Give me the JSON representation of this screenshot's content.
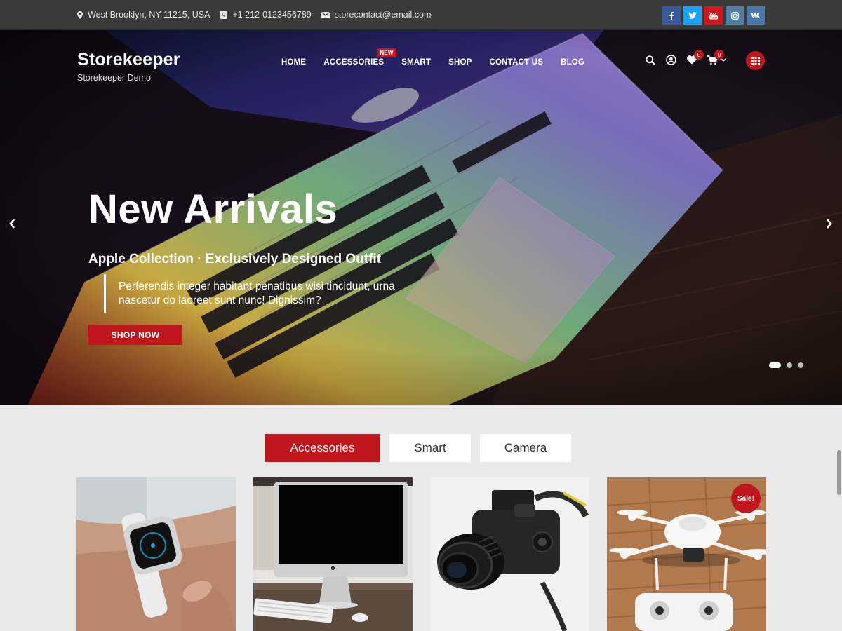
{
  "topbar": {
    "address": "West Brooklyn, NY 11215, USA",
    "phone": "+1 212-0123456789",
    "email": "storecontact@email.com",
    "social": [
      {
        "name": "facebook",
        "icon": "facebook-icon",
        "color": "#3b5998"
      },
      {
        "name": "twitter",
        "icon": "twitter-icon",
        "color": "#1da1f2"
      },
      {
        "name": "youtube",
        "icon": "youtube-icon",
        "color": "#cc181e"
      },
      {
        "name": "instagram",
        "icon": "instagram-icon",
        "color": "#517fa4"
      },
      {
        "name": "vk",
        "icon": "vk-icon",
        "color": "#4a76a8"
      }
    ]
  },
  "header": {
    "brand": "Storekeeper",
    "tagline": "Storekeeper Demo",
    "nav": [
      {
        "label": "HOME"
      },
      {
        "label": "ACCESSORIES",
        "badge": "NEW"
      },
      {
        "label": "SMART"
      },
      {
        "label": "SHOP"
      },
      {
        "label": "CONTACT US"
      },
      {
        "label": "BLOG"
      }
    ],
    "wishlist_count": "0",
    "cart_count": "0"
  },
  "hero": {
    "title": "New Arrivals",
    "subtitle": "Apple Collection · Exclusively Designed Outfit",
    "description": "Perferendis integer habitant penatibus wisi tincidunt, urna nascetur do laoreet sunt nunc! Dignissim?",
    "button": "SHOP NOW",
    "slides": 3,
    "active_slide": 1
  },
  "tabs": {
    "items": [
      "Accessories",
      "Smart",
      "Camera"
    ],
    "active": "Accessories"
  },
  "products": [
    {
      "name": "smartwatch-product-image"
    },
    {
      "name": "imac-product-image"
    },
    {
      "name": "camera-product-image"
    },
    {
      "name": "drone-product-image",
      "badge": "Sale!"
    }
  ],
  "colors": {
    "accent": "#c0171e",
    "topbar": "#3a3a3a",
    "page_bg": "#e9e9e9"
  }
}
